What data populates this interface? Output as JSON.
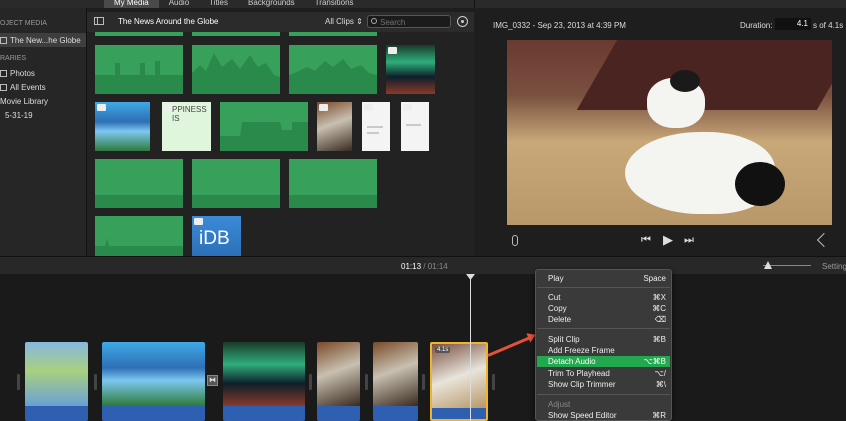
{
  "browser_tabs": [
    "My Media",
    "Audio",
    "Titles",
    "Backgrounds",
    "Transitions"
  ],
  "sidebar": {
    "project_header": "OJECT MEDIA",
    "project_item": "The New...he Globe",
    "libraries_header": "RARIES",
    "items": [
      "Photos",
      "All Events",
      "Movie Library",
      "5-31-19"
    ]
  },
  "browser": {
    "event_title": "The News Around the Globe",
    "filter": "All Clips ⇕",
    "search_placeholder": "Search",
    "happy_text": "PPINESS IS",
    "idb_text": "iDB"
  },
  "viewer": {
    "clip_info": "IMG_0332 - Sep 23, 2013 at 4:39 PM",
    "duration_label": "Duration:",
    "duration_value": "4.1",
    "duration_total": "s of 4.1s"
  },
  "timeline": {
    "timecode_current": "01:13",
    "timecode_sep": " / ",
    "timecode_total": "01:14",
    "settings_label": "Settings",
    "clip_badge": "4.1s"
  },
  "context_menu": {
    "groups": [
      [
        {
          "label": "Play",
          "shortcut": "Space"
        }
      ],
      [
        {
          "label": "Cut",
          "shortcut": "⌘X"
        },
        {
          "label": "Copy",
          "shortcut": "⌘C"
        },
        {
          "label": "Delete",
          "shortcut": "⌫"
        }
      ],
      [
        {
          "label": "Split Clip",
          "shortcut": "⌘B"
        },
        {
          "label": "Add Freeze Frame",
          "shortcut": ""
        },
        {
          "label": "Detach Audio",
          "shortcut": "⌥⌘B",
          "highlighted": true
        },
        {
          "label": "Trim To Playhead",
          "shortcut": "⌥/"
        },
        {
          "label": "Show Clip Trimmer",
          "shortcut": "⌘\\"
        }
      ],
      [
        {
          "label": "Adjust",
          "shortcut": "",
          "disabled": true
        },
        {
          "label": "Show Speed Editor",
          "shortcut": "⌘R"
        }
      ]
    ]
  },
  "colors": {
    "accent_green": "#23a84f",
    "audio_green": "#37a15b",
    "selection_yellow": "#f0b429",
    "arrow_red": "#e4513a",
    "timeline_audio_blue": "#2f5fb0"
  }
}
